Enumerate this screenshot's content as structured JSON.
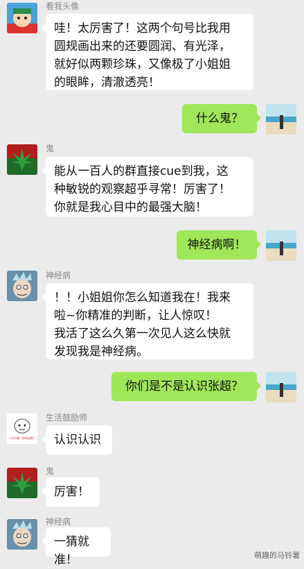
{
  "messages": [
    {
      "sender": "看我头像",
      "text": "哇！太厉害了！这两个句号比我用\n圆规画出来的还要圆润、有光泽，\n就好似两颗珍珠，又像极了小姐姐\n的眼眸，清澈透亮！"
    },
    {
      "sender": "",
      "text": "什么鬼？"
    },
    {
      "sender": "鬼",
      "text": "能从一百人的群直接cue到我，这\n种敏锐的观察超乎寻常！厉害了！\n你就是我心目中的最强大脑！"
    },
    {
      "sender": "",
      "text": "神经病啊！"
    },
    {
      "sender": "神经病",
      "text": "！！小姐姐你怎么知道我在！我来\n啦~你精准的判断，让人惊叹！\n我活了这么久第一次见人这么快就\n发现我是神经病。"
    },
    {
      "sender": "",
      "text": "你们是不是认识张超？"
    },
    {
      "sender": "生活鼓励师",
      "text": "认识认识"
    },
    {
      "sender": "鬼",
      "text": "厉害！"
    },
    {
      "sender": "神经病",
      "text": "一猜就准！"
    }
  ],
  "avatar_labels": {
    "encourager": "一百不够！那再加呢？"
  },
  "watermark": "萌趣的马铃薯",
  "colors": {
    "chat_bg": "#ebebeb",
    "self_bubble": "#9fe658",
    "other_bubble": "#ffffff"
  },
  "icons": [
    "cartoon-avatar-icon",
    "cannabis-leaf-avatar-icon",
    "rick-avatar-icon",
    "beach-photo-avatar-icon",
    "meme-face-avatar-icon"
  ]
}
